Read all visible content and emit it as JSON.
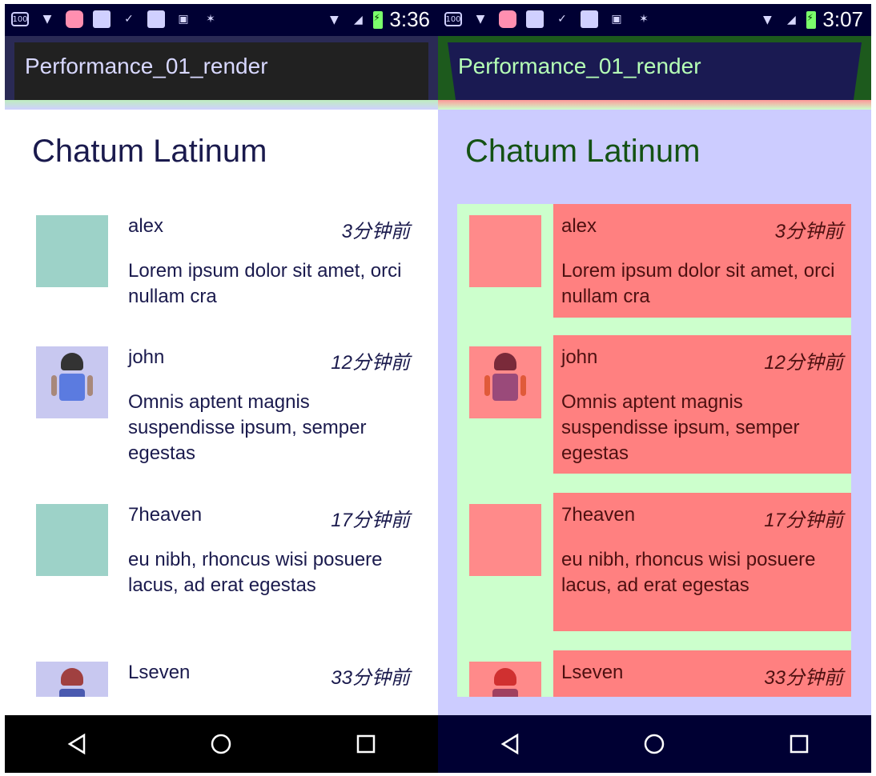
{
  "screens": [
    {
      "status_bar": {
        "time": "3:36",
        "battery_label": "100"
      },
      "app_title": "Performance_01_render",
      "heading": "Chatum Latinum",
      "messages": [
        {
          "name": "alex",
          "time_ago": "3分钟前",
          "text": "Lorem ipsum dolor sit amet, orci nullam cra",
          "avatar": "placeholder"
        },
        {
          "name": "john",
          "time_ago": "12分钟前",
          "text": "Omnis aptent magnis suspendisse ipsum, semper egestas",
          "avatar": "android-girl-icon"
        },
        {
          "name": "7heaven",
          "time_ago": "17分钟前",
          "text": "eu nibh, rhoncus wisi posuere lacus, ad erat egestas",
          "avatar": "placeholder"
        },
        {
          "name": "Lseven",
          "time_ago": "33分钟前",
          "text": "",
          "avatar": "android-boy-icon"
        }
      ]
    },
    {
      "status_bar": {
        "time": "3:07",
        "battery_label": "100"
      },
      "app_title": "Performance_01_render",
      "heading": "Chatum Latinum",
      "messages": [
        {
          "name": "alex",
          "time_ago": "3分钟前",
          "text": "Lorem ipsum dolor sit amet, orci nullam cra",
          "avatar": "placeholder"
        },
        {
          "name": "john",
          "time_ago": "12分钟前",
          "text": "Omnis aptent magnis suspendisse ipsum, semper egestas",
          "avatar": "android-girl-icon"
        },
        {
          "name": "7heaven",
          "time_ago": "17分钟前",
          "text": "eu nibh, rhoncus wisi posuere lacus, ad erat egestas",
          "avatar": "placeholder"
        },
        {
          "name": "Lseven",
          "time_ago": "33分钟前",
          "text": "",
          "avatar": "android-boy-icon"
        }
      ]
    }
  ],
  "overdraw_colors": {
    "none": "#ffffff",
    "one_x": "#ccccff",
    "two_x": "#ccffcc",
    "three_x": "#ff8080"
  },
  "nav_icons": [
    "back-icon",
    "home-icon",
    "recents-icon"
  ]
}
